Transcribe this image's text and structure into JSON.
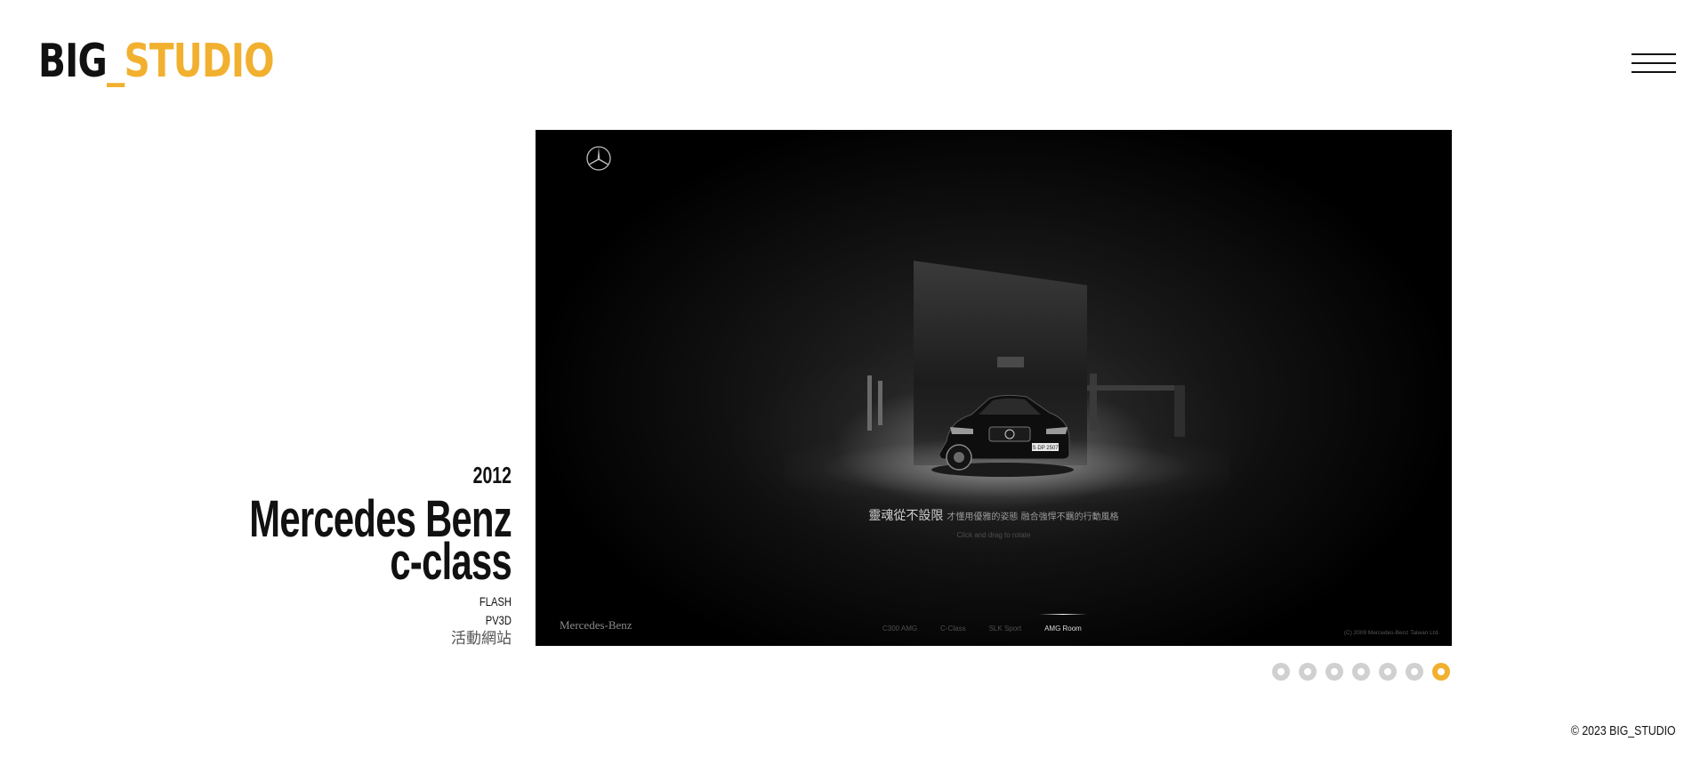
{
  "header": {
    "logo": {
      "part1": "BIG",
      "part2": "_STUDIO"
    },
    "menu_icon": "hamburger-icon"
  },
  "project": {
    "year": "2012",
    "title_line1": "Mercedes Benz",
    "title_line2": "c-class",
    "tags": [
      "FLASH",
      "PV3D",
      "活動網站"
    ]
  },
  "preview": {
    "brand_logo_icon": "mercedes-star-icon",
    "tagline_main": "靈魂從不設限",
    "tagline_sub": "才懂用優雅的姿態 融合強悍不羈的行動風格",
    "hint": "Click and drag to rotate",
    "brand_text": "Mercedes-Benz",
    "nav_items": [
      "C300 AMG",
      "C-Class",
      "SLK Sport",
      "AMG Room"
    ],
    "nav_active": "AMG Room",
    "copyright": "(C) 2009 Mercedes-Benz Taiwan Ltd."
  },
  "pagination": {
    "total": 7,
    "current": 7
  },
  "footer": {
    "copyright": "© 2023 BIG_STUDIO"
  },
  "colors": {
    "accent": "#f2b02f",
    "text": "#111111",
    "dot_inactive": "#d0d0d0"
  }
}
